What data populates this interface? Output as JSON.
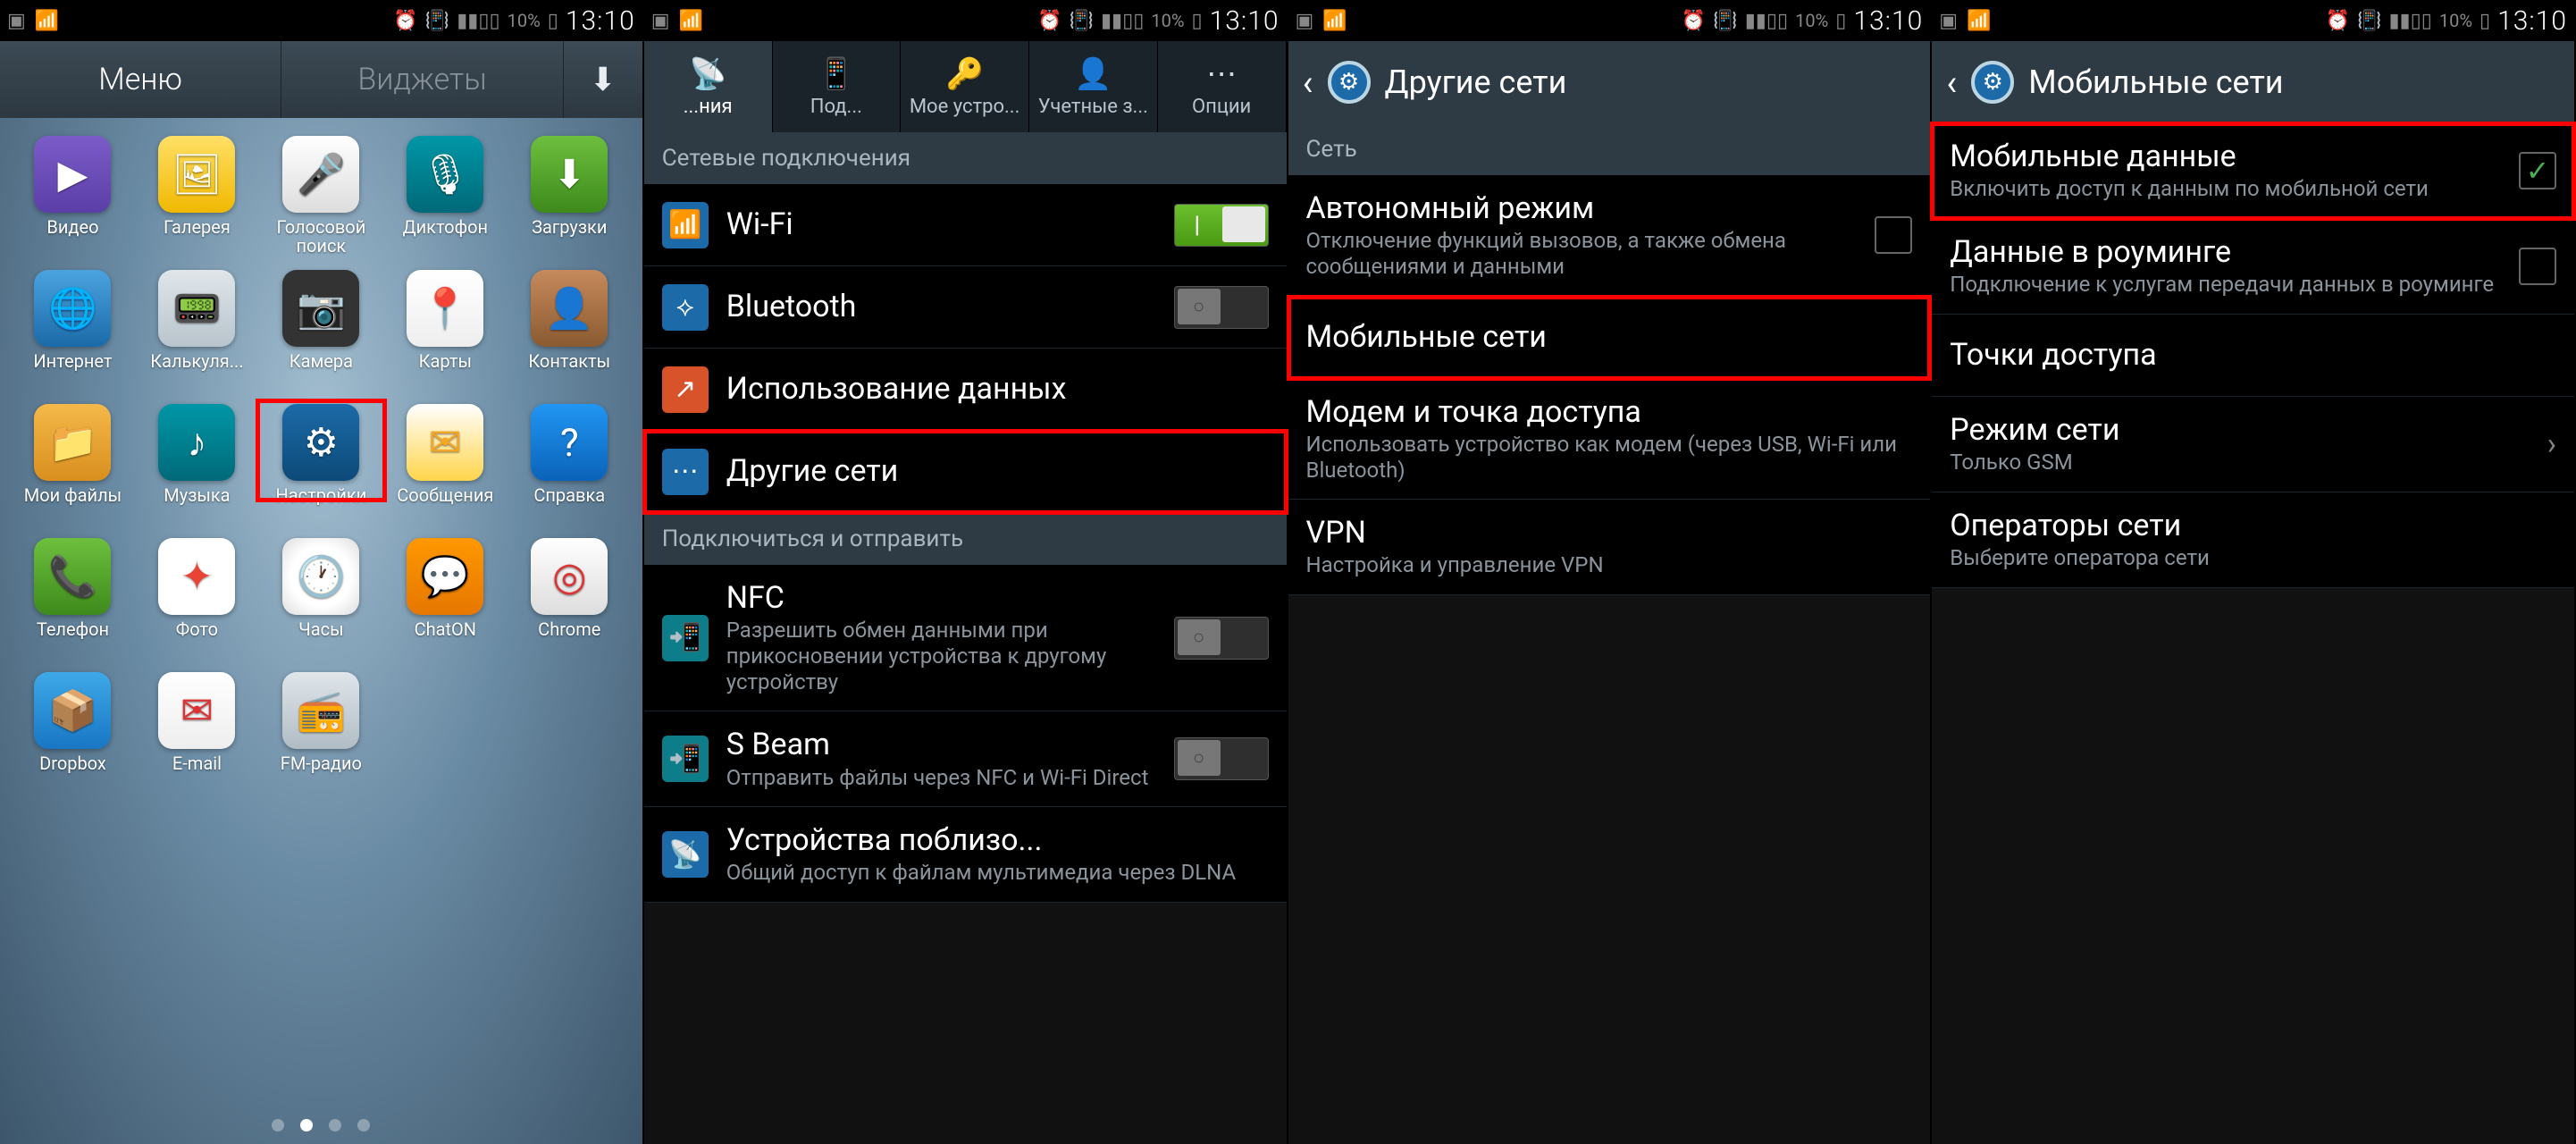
{
  "status": {
    "battery": "10%",
    "time": "13:10"
  },
  "s1": {
    "tabs": {
      "menu": "Меню",
      "widgets": "Виджеты"
    },
    "apps": [
      {
        "l": "Видео",
        "g": "▶",
        "c": "bg-purple"
      },
      {
        "l": "Галерея",
        "g": "🖼",
        "c": "bg-yellow"
      },
      {
        "l": "Голосовой поиск",
        "g": "🎤",
        "c": "bg-white"
      },
      {
        "l": "Диктофон",
        "g": "🎙",
        "c": "bg-teal"
      },
      {
        "l": "Загрузки",
        "g": "⬇",
        "c": "bg-green"
      },
      {
        "l": "Интернет",
        "g": "🌐",
        "c": "bg-globe"
      },
      {
        "l": "Калькуля...",
        "g": "📟",
        "c": "bg-grey"
      },
      {
        "l": "Камера",
        "g": "📷",
        "c": "bg-cam"
      },
      {
        "l": "Карты",
        "g": "📍",
        "c": "bg-maps"
      },
      {
        "l": "Контакты",
        "g": "👤",
        "c": "bg-cont"
      },
      {
        "l": "Мои файлы",
        "g": "📁",
        "c": "bg-folder"
      },
      {
        "l": "Музыка",
        "g": "♪",
        "c": "bg-teal"
      },
      {
        "l": "Настройки",
        "g": "⚙",
        "c": "bg-set"
      },
      {
        "l": "Сообщения",
        "g": "✉",
        "c": "bg-msg"
      },
      {
        "l": "Справка",
        "g": "?",
        "c": "bg-help"
      },
      {
        "l": "Телефон",
        "g": "📞",
        "c": "bg-green"
      },
      {
        "l": "Фото",
        "g": "✦",
        "c": "bg-gphoto"
      },
      {
        "l": "Часы",
        "g": "🕐",
        "c": "bg-clock"
      },
      {
        "l": "ChatON",
        "g": "💬",
        "c": "bg-orange"
      },
      {
        "l": "Chrome",
        "g": "◎",
        "c": "bg-white"
      },
      {
        "l": "Dropbox",
        "g": "📦",
        "c": "bg-drop"
      },
      {
        "l": "E-mail",
        "g": "✉",
        "c": "bg-mail"
      },
      {
        "l": "FM-радио",
        "g": "📻",
        "c": "bg-radio"
      }
    ],
    "highlight_index": 12
  },
  "s2": {
    "tabs": [
      {
        "l": "...ния",
        "g": "📡"
      },
      {
        "l": "Под...",
        "g": "📱"
      },
      {
        "l": "Мое устро...",
        "g": "🔑"
      },
      {
        "l": "Учетные з...",
        "g": "👤"
      },
      {
        "l": "Опции",
        "g": "⋯"
      }
    ],
    "sec1": "Сетевые подключения",
    "rows1": [
      {
        "t": "Wi-Fi",
        "ic": "📶",
        "bg": "#1c6aa8",
        "tg": "on"
      },
      {
        "t": "Bluetooth",
        "ic": "⟡",
        "bg": "#1c6aa8",
        "tg": "off"
      },
      {
        "t": "Использование данных",
        "ic": "↗",
        "bg": "#d8532a"
      },
      {
        "t": "Другие сети",
        "ic": "⋯",
        "bg": "#1c6aa8",
        "hl": true
      }
    ],
    "sec2": "Подключиться и отправить",
    "rows2": [
      {
        "t": "NFC",
        "s": "Разрешить обмен данными при прикосновении устройства к другому устройству",
        "ic": "📲",
        "bg": "#0e7d8a",
        "tg": "off"
      },
      {
        "t": "S Beam",
        "s": "Отправить файлы через NFC и Wi-Fi Direct",
        "ic": "📲",
        "bg": "#0e7d8a",
        "tg": "off"
      },
      {
        "t": "Устройства поблизо...",
        "s": "Общий доступ к файлам мультимедиа через DLNA",
        "ic": "📡",
        "bg": "#1c6aa8"
      }
    ]
  },
  "s3": {
    "title": "Другие сети",
    "sec": "Сеть",
    "rows": [
      {
        "t": "Автономный режим",
        "s": "Отключение функций вызовов, а также обмена сообщениями и данными",
        "chk": false
      },
      {
        "t": "Мобильные сети",
        "hl": true
      },
      {
        "t": "Модем и точка доступа",
        "s": "Использовать устройство как модем (через USB, Wi-Fi или Bluetooth)"
      },
      {
        "t": "VPN",
        "s": "Настройка и управление VPN"
      }
    ]
  },
  "s4": {
    "title": "Мобильные сети",
    "rows": [
      {
        "t": "Мобильные данные",
        "s": "Включить доступ к данным по мобильной сети",
        "chk": true,
        "hl": true
      },
      {
        "t": "Данные в роуминге",
        "s": "Подключение к услугам передачи данных в роуминге",
        "chk": false
      },
      {
        "t": "Точки доступа"
      },
      {
        "t": "Режим сети",
        "s": "Только GSM",
        "chev": true
      },
      {
        "t": "Операторы сети",
        "s": "Выберите оператора сети"
      }
    ]
  }
}
